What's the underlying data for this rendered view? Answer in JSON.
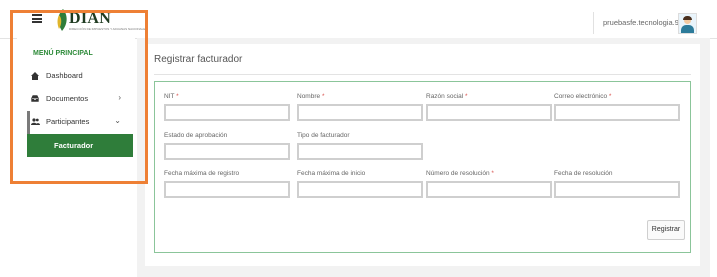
{
  "header": {
    "logo_text": "DIAN",
    "logo_subtitle": "DIRECCIÓN DE IMPUESTOS Y ADUANAS NACIONALES",
    "user_name": "pruebasfe.tecnologia.9..."
  },
  "sidebar": {
    "title": "MENÚ PRINCIPAL",
    "items": [
      {
        "label": "Dashboard",
        "icon": "dashboard-icon"
      },
      {
        "label": "Documentos",
        "icon": "inbox-icon",
        "chevron": "›"
      },
      {
        "label": "Participantes",
        "icon": "users-icon",
        "chevron": "⌄"
      }
    ],
    "submenu_item": "Facturador"
  },
  "main": {
    "title": "Registrar facturador",
    "fields": [
      {
        "label": "NIT",
        "required": true
      },
      {
        "label": "Nombre",
        "required": true
      },
      {
        "label": "Razón social",
        "required": true
      },
      {
        "label": "Correo electrónico",
        "required": true
      },
      {
        "label": "Estado de aprobación",
        "required": false
      },
      {
        "label": "Tipo de facturador",
        "required": false
      },
      {
        "label": "Fecha máxima de registro",
        "required": false
      },
      {
        "label": "Fecha máxima de inicio",
        "required": false
      },
      {
        "label": "Número de resolución",
        "required": true
      },
      {
        "label": "Fecha de resolución",
        "required": false
      }
    ],
    "required_mark": "*",
    "submit_label": "Registrar"
  },
  "colors": {
    "brand_green": "#2f7d3a",
    "highlight_orange": "#ee8035",
    "form_border": "#8bc59a"
  }
}
